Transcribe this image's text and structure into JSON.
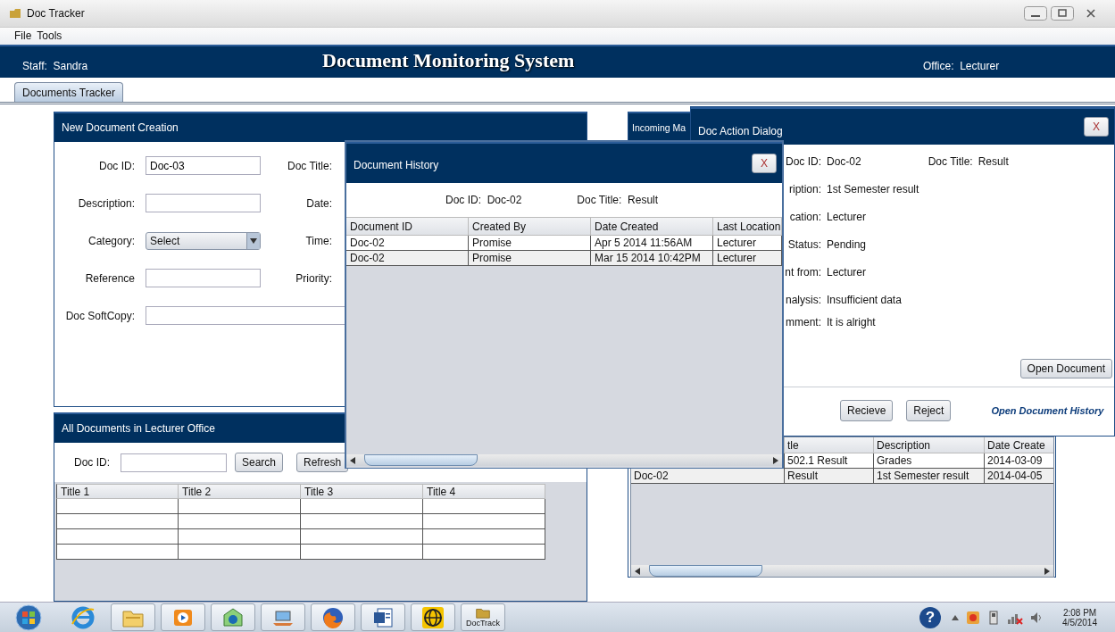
{
  "window": {
    "title": "Doc Tracker"
  },
  "menu": [
    "File",
    "Tools"
  ],
  "header": {
    "staff_label": "Staff:",
    "staff": "Sandra",
    "title": "Document Monitoring System",
    "office_label": "Office:",
    "office": "Lecturer"
  },
  "tabs": [
    {
      "label": "Documents Tracker",
      "selected": true
    }
  ],
  "new_document": {
    "title": "New Document Creation",
    "fields": [
      {
        "label": "Doc ID:",
        "kind": "text",
        "value": "Doc-03",
        "side_label": "Doc Title:"
      },
      {
        "label": "Description:",
        "kind": "text",
        "side_label": "Date:"
      },
      {
        "label": "Category:",
        "kind": "select",
        "value": "Select",
        "side_label": "Time:"
      },
      {
        "label": "Reference",
        "kind": "text",
        "side_label": "Priority:"
      },
      {
        "label": "Doc SoftCopy:",
        "kind": "wide"
      }
    ]
  },
  "all_documents": {
    "title": "All Documents in Lecturer Office",
    "search_label": "Doc ID:",
    "buttons": [
      "Search",
      "Refresh"
    ],
    "columns": [
      "Title 1",
      "Title 2",
      "Title 3",
      "Title 4"
    ]
  },
  "incoming": {
    "title": "Incoming Ma",
    "columns": [
      "tle",
      "Description",
      "Date Create"
    ],
    "rows": [
      {
        "cells": [
          "502.1 Result",
          "Grades",
          "2014-03-09"
        ]
      },
      {
        "id": "Doc-02",
        "cells": [
          "Result",
          "1st Semester result",
          "2014-04-05"
        ]
      }
    ]
  },
  "action_dialog": {
    "title": "Doc Action Dialog",
    "close": "X",
    "doc_id_label": "Doc ID:",
    "doc_id": "Doc-02",
    "doc_title_label": "Doc Title:",
    "doc_title": "Result",
    "fields": [
      {
        "label": "ription:",
        "value": "1st Semester result"
      },
      {
        "label": "cation:",
        "value": "Lecturer"
      },
      {
        "label": "Status:",
        "value": "Pending"
      },
      {
        "label": "nt from:",
        "value": "Lecturer"
      },
      {
        "label": "nalysis:",
        "value": "Insufficient data"
      },
      {
        "label": "mment:",
        "value": "It is alright"
      }
    ],
    "open_button": "Open Document",
    "buttons": [
      "Recieve",
      "Reject"
    ],
    "history_link": "Open Document History"
  },
  "history_dialog": {
    "title": "Document History",
    "close": "X",
    "doc_id_label": "Doc ID:",
    "doc_id": "Doc-02",
    "doc_title_label": "Doc Title:",
    "doc_title": "Result",
    "columns": [
      "Document ID",
      "Created By",
      "Date Created",
      "Last Location"
    ],
    "rows": [
      [
        "Doc-02",
        "Promise",
        "Apr  5 2014 11:56AM",
        "Lecturer"
      ],
      [
        "Doc-02",
        "Promise",
        "Mar 15 2014 10:42PM",
        "Lecturer"
      ]
    ]
  },
  "taskbar": {
    "apps": [
      {
        "kind": "ie"
      },
      {
        "kind": "explorer"
      },
      {
        "kind": "media"
      },
      {
        "kind": "hp"
      },
      {
        "kind": "laptop"
      },
      {
        "kind": "firefox"
      },
      {
        "kind": "word"
      },
      {
        "kind": "globe"
      },
      {
        "kind": "folder",
        "label": "DocTrack"
      }
    ],
    "help": "?",
    "time": "2:08 PM",
    "date": "4/5/2014"
  }
}
